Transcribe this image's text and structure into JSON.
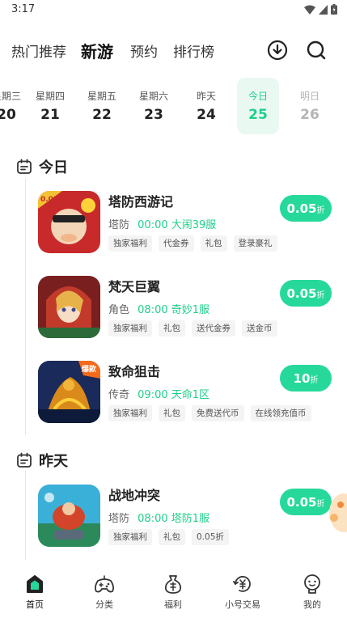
{
  "status_bar": {
    "time": "3:17"
  },
  "top_nav": {
    "tabs": [
      {
        "label": "热门推荐",
        "active": false
      },
      {
        "label": "新游",
        "active": true
      },
      {
        "label": "预约",
        "active": false
      },
      {
        "label": "排行榜",
        "active": false
      }
    ],
    "icons": [
      "download-icon",
      "search-icon"
    ]
  },
  "date_strip": [
    {
      "dow": "星期三",
      "day": "20"
    },
    {
      "dow": "星期四",
      "day": "21"
    },
    {
      "dow": "星期五",
      "day": "22"
    },
    {
      "dow": "星期六",
      "day": "23"
    },
    {
      "dow": "昨天",
      "day": "24"
    },
    {
      "dow": "今日",
      "day": "25",
      "selected": true
    },
    {
      "dow": "明日",
      "day": "26",
      "future": true
    }
  ],
  "sections": [
    {
      "title": "今日",
      "games": [
        {
          "name": "塔防西游记",
          "genre": "塔防",
          "server": "00:00 大闹39服",
          "tags": [
            "独家福利",
            "代金券",
            "礼包",
            "登录豪礼"
          ],
          "discount": "0.05",
          "discount_unit": "折"
        },
        {
          "name": "梵天巨翼",
          "genre": "角色",
          "server": "08:00 奇妙1服",
          "tags": [
            "独家福利",
            "礼包",
            "送代金券",
            "送金币"
          ],
          "discount": "0.05",
          "discount_unit": "折"
        },
        {
          "name": "致命狙击",
          "genre": "传奇",
          "server": "09:00 天命1区",
          "tags": [
            "独家福利",
            "礼包",
            "免费送代币",
            "在线领充值币"
          ],
          "discount": "10",
          "discount_unit": "折"
        }
      ]
    },
    {
      "title": "昨天",
      "games": [
        {
          "name": "战地冲突",
          "genre": "塔防",
          "server": "08:00 塔防1服",
          "tags": [
            "独家福利",
            "礼包",
            "0.05折"
          ],
          "discount": "0.05",
          "discount_unit": "折"
        }
      ]
    }
  ],
  "bottom_nav": [
    {
      "label": "首页",
      "icon": "home-icon",
      "active": true
    },
    {
      "label": "分类",
      "icon": "gamepad-icon",
      "active": false
    },
    {
      "label": "福利",
      "icon": "gift-bag-icon",
      "active": false
    },
    {
      "label": "小号交易",
      "icon": "yen-trade-icon",
      "active": false
    },
    {
      "label": "我的",
      "icon": "profile-icon",
      "active": false
    }
  ],
  "colors": {
    "accent": "#26d99a",
    "accent_text": "#1fcf8a",
    "today_bg": "#e9f9f1"
  }
}
